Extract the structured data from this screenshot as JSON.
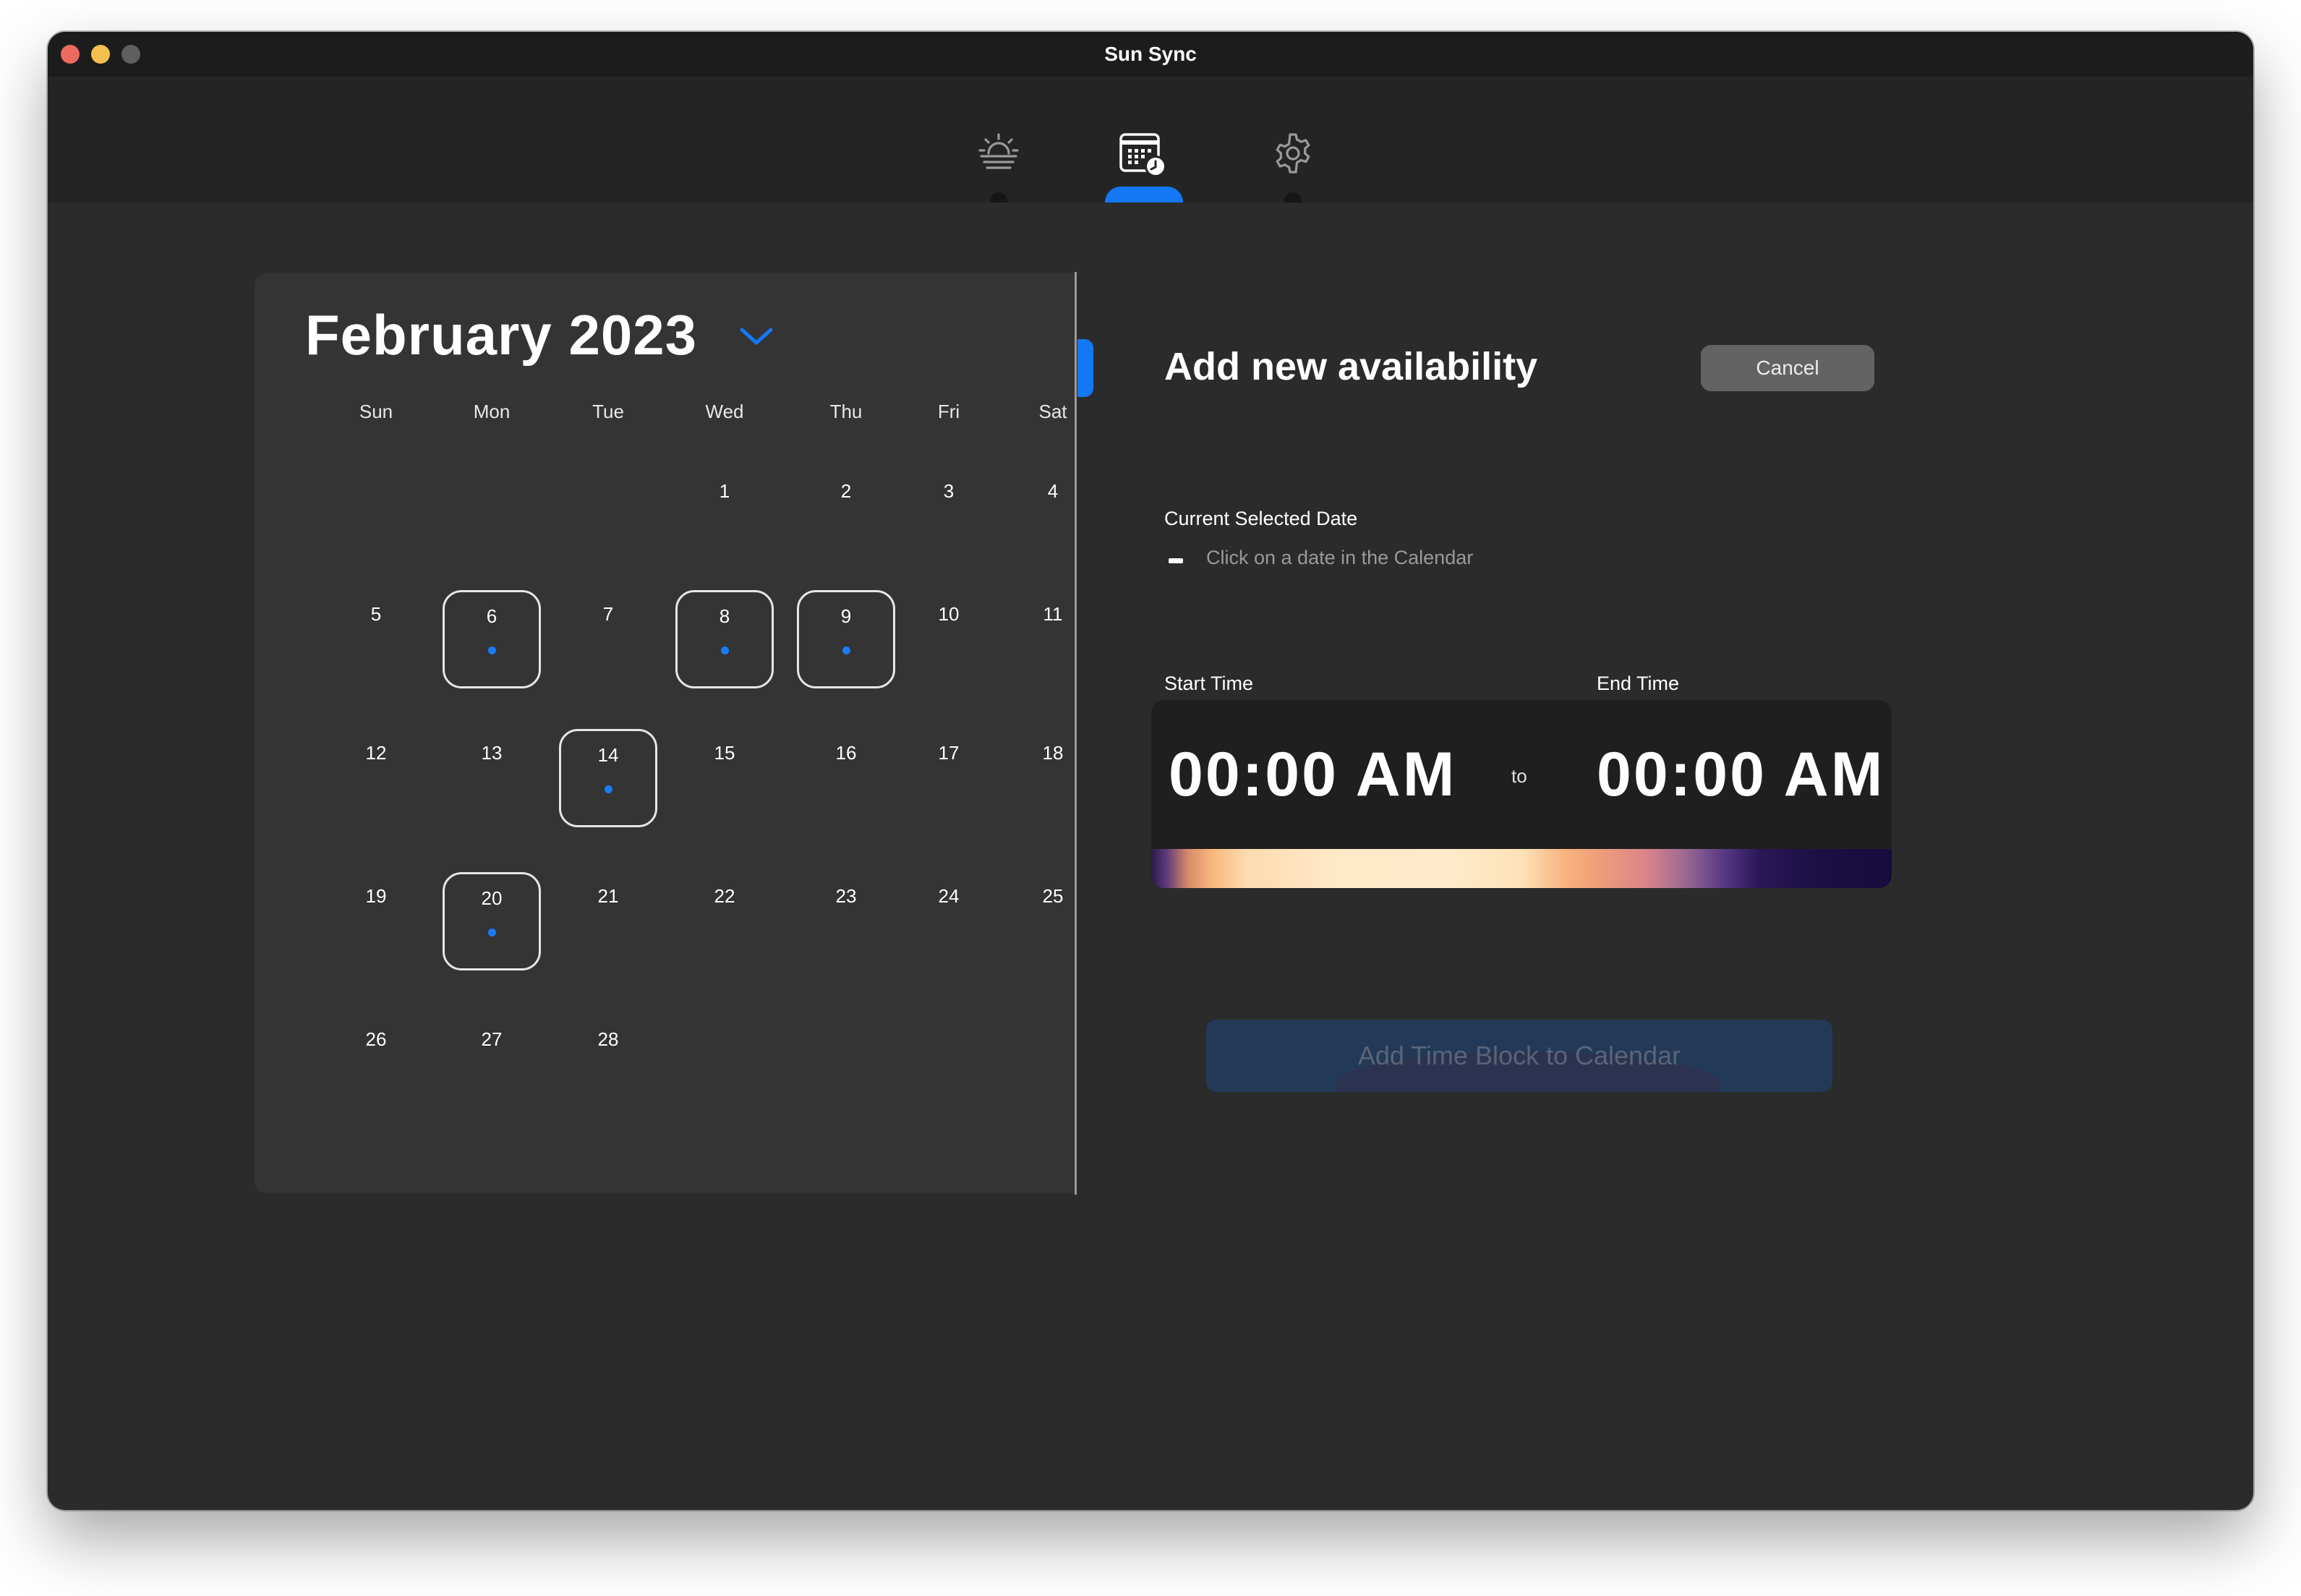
{
  "window": {
    "title": "Sun Sync"
  },
  "toolbar": {
    "items": [
      {
        "id": "sun",
        "icon": "sunrise-icon"
      },
      {
        "id": "schedule",
        "icon": "calendar-clock-icon",
        "active": true
      },
      {
        "id": "settings",
        "icon": "gear-icon"
      }
    ]
  },
  "calendar": {
    "month_label": "February 2023",
    "weekdays": [
      "Sun",
      "Mon",
      "Tue",
      "Wed",
      "Thu",
      "Fri",
      "Sat"
    ],
    "weeks": [
      [
        "",
        "",
        "",
        "1",
        "2",
        "3",
        "4"
      ],
      [
        "5",
        "6",
        "7",
        "8",
        "9",
        "10",
        "11"
      ],
      [
        "12",
        "13",
        "14",
        "15",
        "16",
        "17",
        "18"
      ],
      [
        "19",
        "20",
        "21",
        "22",
        "23",
        "24",
        "25"
      ],
      [
        "26",
        "27",
        "28",
        "",
        "",
        "",
        ""
      ]
    ],
    "days_with_availability": [
      "6",
      "8",
      "9",
      "14",
      "20"
    ]
  },
  "form": {
    "heading": "Add new availability",
    "cancel_label": "Cancel",
    "selected_date_label": "Current Selected Date",
    "selected_date_hint": "Click on a date in the Calendar",
    "start_time_label": "Start Time",
    "end_time_label": "End Time",
    "start_time": "00:00 AM",
    "end_time": "00:00 AM",
    "to_label": "to",
    "submit_label": "Add Time Block to Calendar"
  },
  "colors": {
    "accent": "#1478f5",
    "window_bg": "#2b2b2b",
    "panel_bg": "#343434"
  }
}
